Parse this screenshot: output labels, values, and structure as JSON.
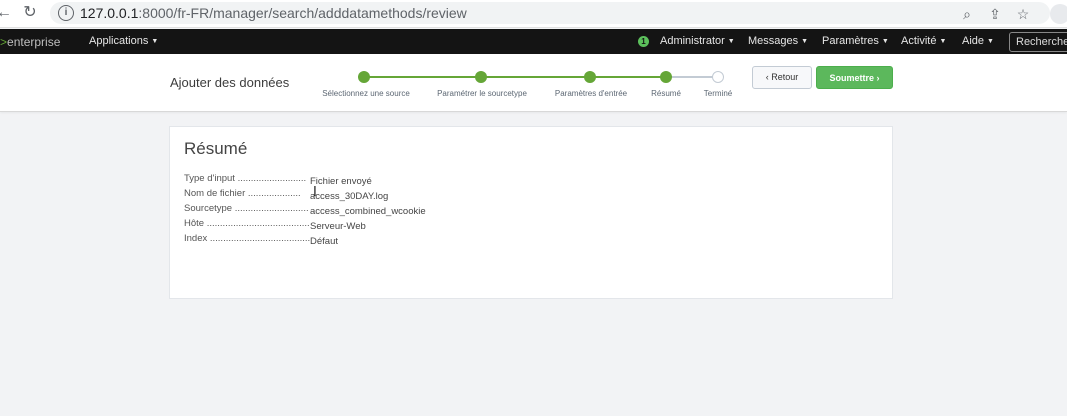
{
  "browser": {
    "url_host": "127.0.0.1",
    "url_path": ":8000/fr-FR/manager/search/adddatamethods/review"
  },
  "topnav": {
    "logo_prefix": ">",
    "logo_text": "enterprise",
    "apps_label": "Applications",
    "status_count": "1",
    "user_label": "Administrator",
    "messages_label": "Messages",
    "settings_label": "Paramètres",
    "activity_label": "Activité",
    "help_label": "Aide",
    "search_label": "Rechercher"
  },
  "wizard": {
    "title": "Ajouter des données",
    "steps": [
      {
        "label": "Sélectionnez une source",
        "done": true
      },
      {
        "label": "Paramétrer le sourcetype",
        "done": true
      },
      {
        "label": "Paramètres d'entrée",
        "done": true
      },
      {
        "label": "Résumé",
        "done": true
      },
      {
        "label": "Terminé",
        "done": false
      }
    ],
    "back_label": "‹ Retour",
    "submit_label": "Soumettre ›"
  },
  "summary": {
    "title": "Résumé",
    "rows": [
      {
        "key": "Type d'input ..........................",
        "value": "Fichier envoyé"
      },
      {
        "key": "Nom de fichier ....................",
        "value": "access_30DAY.log"
      },
      {
        "key": "Sourcetype ............................",
        "value": "access_combined_wcookie"
      },
      {
        "key": "Hôte .......................................",
        "value": "Serveur-Web"
      },
      {
        "key": "Index ......................................",
        "value": "Défaut"
      }
    ]
  },
  "colors": {
    "accent": "#65a637",
    "submit": "#5cb85c",
    "navbar": "#141414"
  },
  "icons": [
    "back-arrow-icon",
    "forward-arrow-icon",
    "reload-icon",
    "site-info-icon",
    "zoom-icon",
    "share-icon",
    "bookmark-star-icon",
    "profile-icon",
    "text-cursor-icon"
  ]
}
